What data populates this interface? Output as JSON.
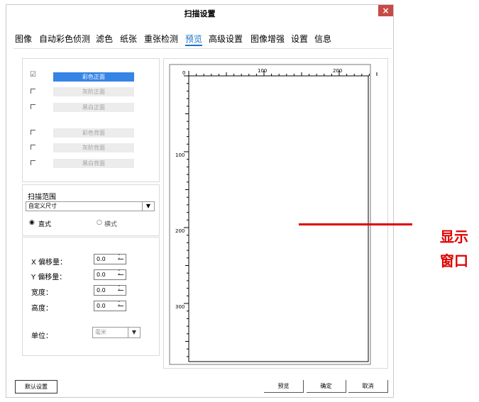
{
  "window": {
    "title": "扫描设置",
    "close_glyph": "×"
  },
  "tabs": [
    {
      "label": "图像"
    },
    {
      "label": "自动彩色侦测"
    },
    {
      "label": "滤色"
    },
    {
      "label": "纸张"
    },
    {
      "label": "重张检测"
    },
    {
      "label": "预览",
      "active": true
    },
    {
      "label": "高级设置"
    },
    {
      "label": "图像增强"
    },
    {
      "label": "设置"
    },
    {
      "label": "信息"
    }
  ],
  "modes": [
    {
      "label": "彩色正面",
      "checked": true,
      "selected": true
    },
    {
      "label": "灰阶正面",
      "checked": false
    },
    {
      "label": "黑白正面",
      "checked": false
    },
    {
      "label": "彩色背面",
      "checked": false
    },
    {
      "label": "灰阶背面",
      "checked": false
    },
    {
      "label": "黑白背面",
      "checked": false
    }
  ],
  "scan_range": {
    "heading": "扫描范围",
    "select_value": "自定义尺寸",
    "orientation": [
      {
        "label": "直式",
        "selected": true
      },
      {
        "label": "横式",
        "selected": false
      }
    ]
  },
  "offsets": {
    "x_label": "X 偏移量：",
    "x_value": "0.0",
    "y_label": "Y 偏移量：",
    "y_value": "0.0",
    "width_label": "宽度：",
    "width_value": "0.0",
    "height_label": "高度：",
    "height_value": "0.0",
    "unit_label": "单位：",
    "unit_value": "毫米"
  },
  "ruler": {
    "top_labels": [
      "0",
      "100",
      "200"
    ],
    "left_labels": [
      "100",
      "200",
      "300"
    ]
  },
  "buttons": {
    "default": "默认设置",
    "preview": "预览",
    "ok": "确定",
    "cancel": "取消"
  },
  "annotation": {
    "line1": "显示",
    "line2": "窗口",
    "color": "#e00000"
  }
}
